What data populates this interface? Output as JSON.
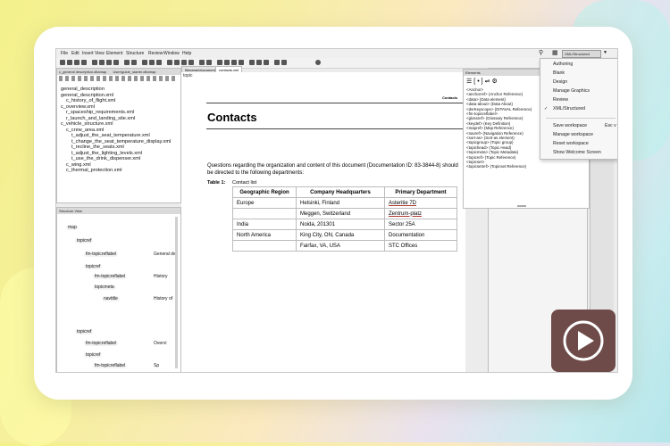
{
  "menu": [
    "File",
    "Edit",
    "Insert",
    "View",
    "Element",
    "Structure",
    "Review",
    "Window",
    "Help"
  ],
  "workspace_selector": "XML/Structured",
  "tabs": [
    "filename/document",
    "contacts.xml"
  ],
  "left_top_pane": {
    "title": "c_general description.ditamap",
    "tab2": "User/guide_starter.ditamap",
    "items": [
      {
        "text": "general_description",
        "indent": 0
      },
      {
        "text": "general_description.xml",
        "indent": 0
      },
      {
        "text": "c_history_of_flight.xml",
        "indent": 1
      },
      {
        "text": "c_overview.xml",
        "indent": 0
      },
      {
        "text": "r_spaceship_requirements.xml",
        "indent": 1
      },
      {
        "text": "r_launch_and_landing_site.xml",
        "indent": 1
      },
      {
        "text": "c_vehicle_structure.xml",
        "indent": 0
      },
      {
        "text": "c_crew_area.xml",
        "indent": 1
      },
      {
        "text": "t_adjust_the_seat_temperature.xml",
        "indent": 2
      },
      {
        "text": "t_change_the_seat_temperature_display.xml",
        "indent": 2
      },
      {
        "text": "t_recline_the_seats.xml",
        "indent": 2
      },
      {
        "text": "t_adjust_the_lighting_levels.xml",
        "indent": 2
      },
      {
        "text": "t_use_the_drink_dispenser.xml",
        "indent": 2
      },
      {
        "text": "c_wing.xml",
        "indent": 1
      },
      {
        "text": "c_thermal_protection.xml",
        "indent": 1
      }
    ]
  },
  "structure_view": {
    "title": "Structure View",
    "nodes": [
      {
        "tag": "map",
        "text": ""
      },
      {
        "tag": "topicref",
        "text": ""
      },
      {
        "tag": "fm-topicreflabel",
        "text": "General de"
      },
      {
        "tag": "topicref",
        "text": ""
      },
      {
        "tag": "fm-topicreflabel",
        "text": "History"
      },
      {
        "tag": "topicmeta",
        "text": ""
      },
      {
        "tag": "navtitle",
        "text": "History of"
      },
      {
        "tag": "topicref",
        "text": ""
      },
      {
        "tag": "fm-topicreflabel",
        "text": "Overvi"
      },
      {
        "tag": "topicref",
        "text": ""
      },
      {
        "tag": "fm-topicreflabel",
        "text": "Sp"
      },
      {
        "tag": "topicmeta",
        "text": ""
      }
    ]
  },
  "document": {
    "topic_label": "topic",
    "header_right": "Contacts",
    "heading": "Contacts",
    "intro": "Questions regarding the organization and content of this document (Documentation ID: 83-3844-8) should be directed to the following departments:",
    "table_label": "Table 1:",
    "table_caption": "Contact list",
    "columns": [
      "Geographic Region",
      "Company Headquarters",
      "Primary Department"
    ],
    "rows": [
      [
        "Europe",
        "Helsinki, Finland",
        "Asteritie 7D"
      ],
      [
        "",
        "Meggen, Switzerland",
        "Zentrum-platz"
      ],
      [
        "India",
        "Noida, 201301",
        "Sector 25A"
      ],
      [
        "North America",
        "King City, ON, Canada",
        "Documentation"
      ],
      [
        "",
        "Fairfax, VA, USA",
        "STC Offices"
      ]
    ]
  },
  "elements_pane": {
    "title": "Elements",
    "items": [
      "<Anchor>",
      "<anchorref> (Anchor Reference)",
      "<data> (Data element)",
      "<data-about> (Data About)",
      "<dvrKeyscope> (DITAVAL Reference)",
      "<fm-topicreflabel>",
      "<glossref> (Glossary Reference)",
      "<keydef> (Key Definition)",
      "<mapref> (Map Reference)",
      "<navref> (Navigation Reference)",
      "<sort-as> (Sort-as element)",
      "<topicgroup> (Topic group)",
      "<topichead> (Topic Head)",
      "<topicmeta> (Topic Metadata)",
      "<topicref> (Topic Reference)",
      "<topicset>",
      "<topicsetref> (Topicset Reference)"
    ]
  },
  "workspace_menu": {
    "items": [
      "Authoring",
      "Blank",
      "Design",
      "Manage Graphics",
      "Review",
      "XML/Structured"
    ],
    "checked": "XML/Structured",
    "actions": [
      {
        "label": "Save workspace",
        "shortcut": "Esc v"
      },
      {
        "label": "Manage workspace",
        "shortcut": ""
      },
      {
        "label": "Reset workspace",
        "shortcut": ""
      },
      {
        "label": "Show Welcome Screen",
        "shortcut": ""
      }
    ]
  },
  "colors": {
    "card": "#ffffff",
    "play_button": "#6e4b49",
    "link_underline": "#b03a2e"
  },
  "icons": [
    "play-icon",
    "search-icon",
    "dropdown-arrow-icon"
  ]
}
